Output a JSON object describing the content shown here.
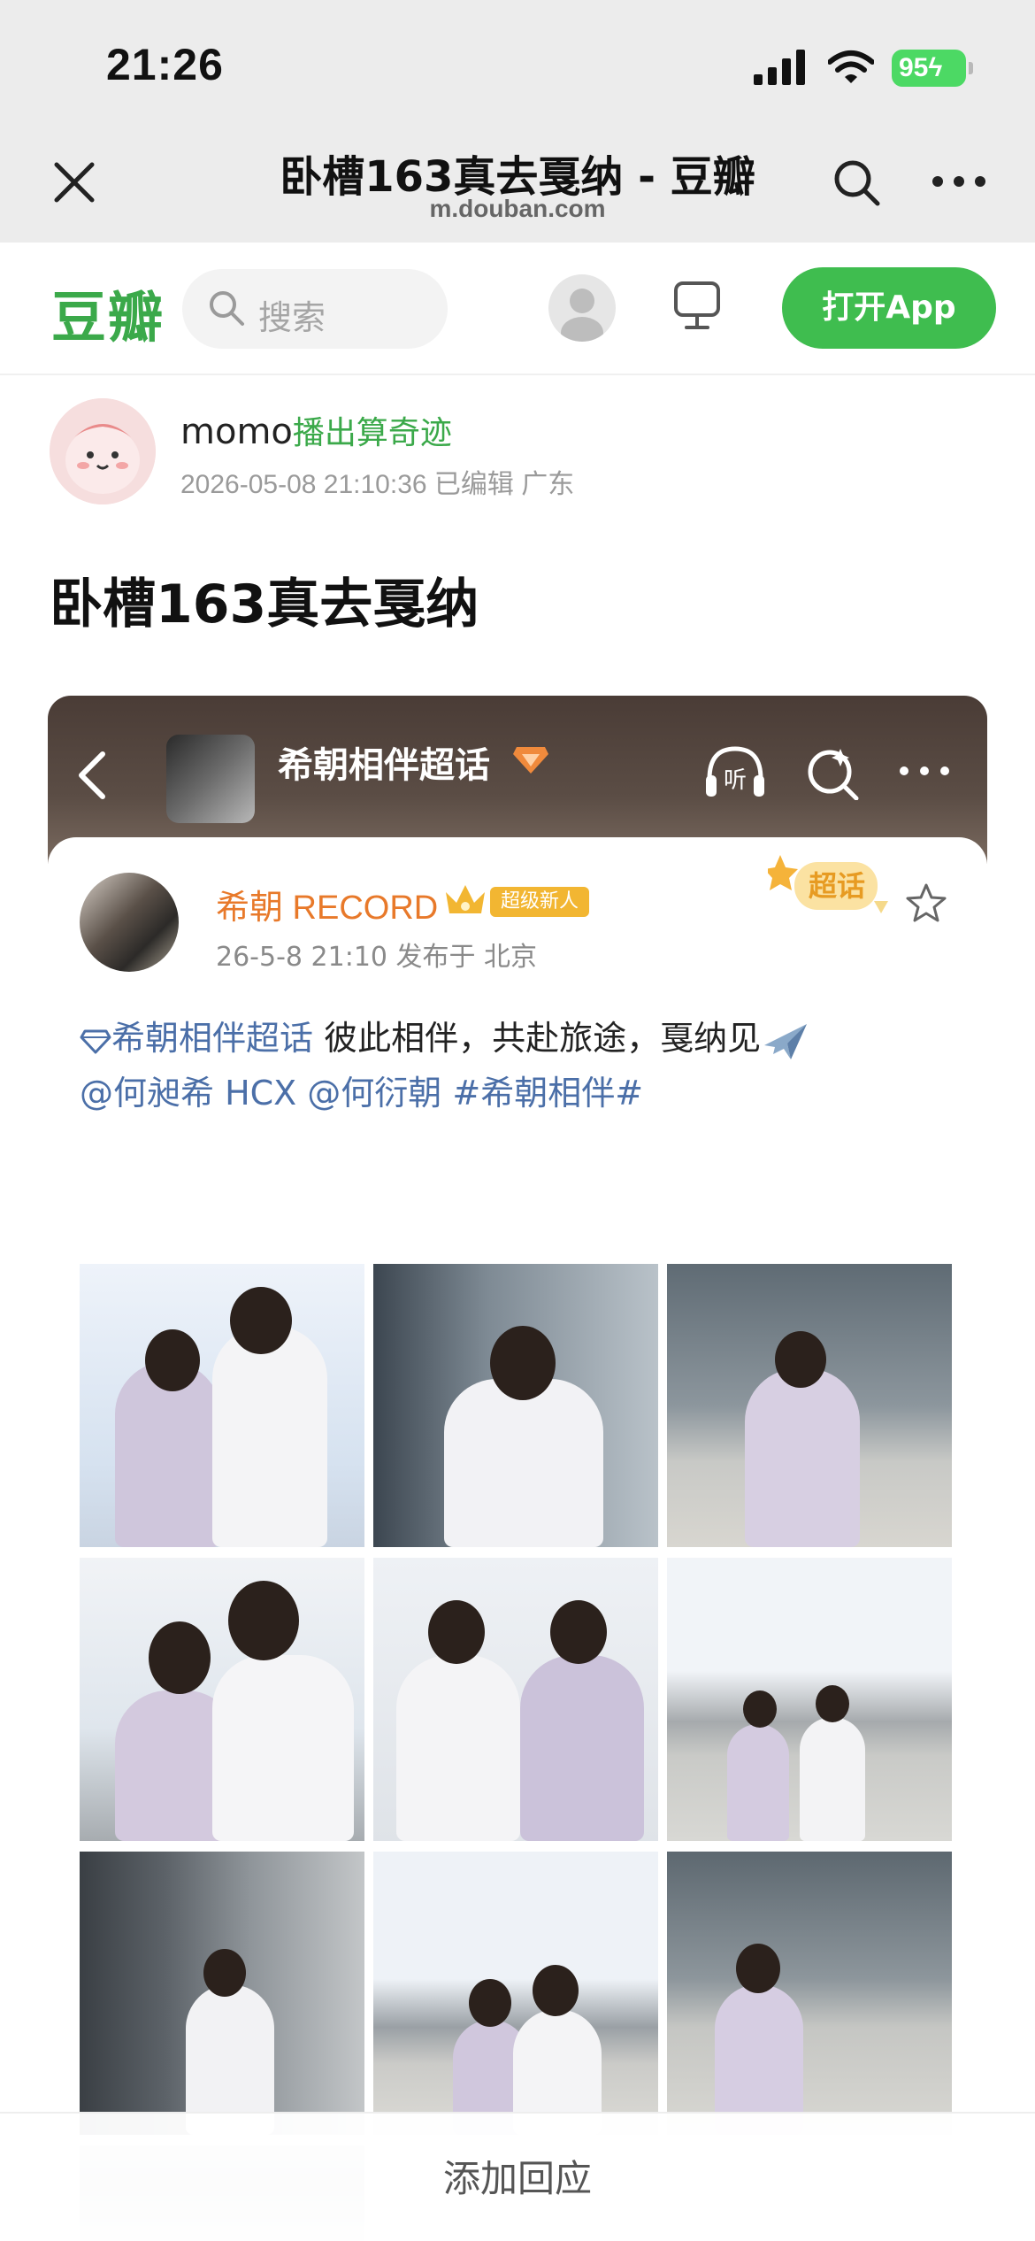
{
  "status_bar": {
    "time": "21:26",
    "battery": "95",
    "icons": [
      "cellular-signal-icon",
      "wifi-icon",
      "battery-charging-icon"
    ]
  },
  "browser": {
    "title": "卧槽163真去戛纳 - 豆瓣",
    "url": "m.douban.com",
    "icons": [
      "close-icon",
      "search-icon",
      "more-icon"
    ]
  },
  "nav": {
    "logo": "豆瓣",
    "search_placeholder": "搜索",
    "open_app": "打开App",
    "accent_color": "#3fbd4f",
    "icons": [
      "search-icon",
      "user-avatar-icon",
      "desktop-icon"
    ]
  },
  "post": {
    "author_nick": "momo",
    "author_tag": "播出算奇迹",
    "meta": "2026-05-08 21:10:36 已编辑 广东",
    "title": "卧槽163真去戛纳"
  },
  "embedded_screenshot": {
    "header_title": "希朝相伴超话",
    "icons": [
      "back-chevron-icon",
      "headphone-listen-icon",
      "magic-search-icon",
      "more-icon"
    ],
    "listen_label": "听",
    "weibo_user": "希朝 RECORD",
    "badge": "超级新人",
    "chaohua_label": "超话",
    "meta": "26-5-8 21:10  发布于 北京",
    "topic": "希朝相伴超话",
    "text": " 彼此相伴，共赴旅途，戛纳见",
    "mentions": "@何昶希 HCX @何衍朝  #希朝相伴#",
    "name_color": "#e8792a",
    "link_color": "#4b6fa8",
    "photo_count": 10
  },
  "bottom_bar": {
    "label": "添加回应"
  }
}
